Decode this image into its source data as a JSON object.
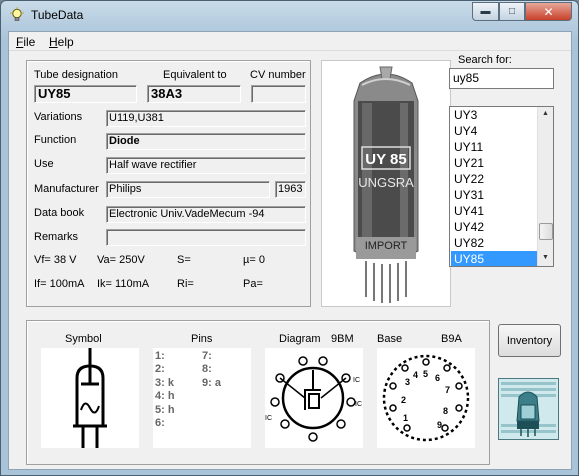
{
  "window": {
    "title": "TubeData"
  },
  "menu": {
    "file": "File",
    "help": "Help"
  },
  "header_labels": {
    "tube_designation": "Tube designation",
    "equivalent_to": "Equivalent to",
    "cv_number": "CV number"
  },
  "tube": {
    "designation": "UY85",
    "equivalent": "38A3",
    "cv_number": "",
    "variations": "U119,U381",
    "function": "Diode",
    "use": "Half wave rectifier",
    "manufacturer": "Philips",
    "year": "1963",
    "data_book": "Electronic Univ.VadeMecum -94",
    "remarks": ""
  },
  "field_labels": {
    "variations": "Variations",
    "function": "Function",
    "use": "Use",
    "manufacturer": "Manufacturer",
    "data_book": "Data book",
    "remarks": "Remarks"
  },
  "params": {
    "vf": "Vf= 38 V",
    "va": "Va=  250V",
    "s": "S=",
    "mu": "µ=    0",
    "if": "If= 100mA",
    "ik": "Ik=   110mA",
    "ri": "Ri=",
    "pa": "Pa="
  },
  "search": {
    "label": "Search for:",
    "value": "uy85"
  },
  "tube_list": {
    "items": [
      "UY3",
      "UY4",
      "UY11",
      "UY21",
      "UY22",
      "UY31",
      "UY41",
      "UY42",
      "UY82",
      "UY85"
    ],
    "selected": "UY85"
  },
  "bottom": {
    "symbol_label": "Symbol",
    "pins_label": "Pins",
    "diagram_label": "Diagram",
    "diagram_code": "9BM",
    "base_label": "Base",
    "base_code": "B9A",
    "pins_left": [
      "1:",
      "2:",
      "3: k",
      "4: h",
      "5: h",
      "6:"
    ],
    "pins_right": [
      "7:",
      "8:",
      "9: a"
    ]
  },
  "buttons": {
    "inventory": "Inventory"
  },
  "photo": {
    "label_top": "UY 85",
    "label_brand": "UNGSRA",
    "label_bottom": "IMPORT"
  },
  "icons": {
    "app": "lightbulb-icon",
    "minimize": "minimize-icon",
    "maximize": "maximize-icon",
    "close": "close-icon"
  }
}
